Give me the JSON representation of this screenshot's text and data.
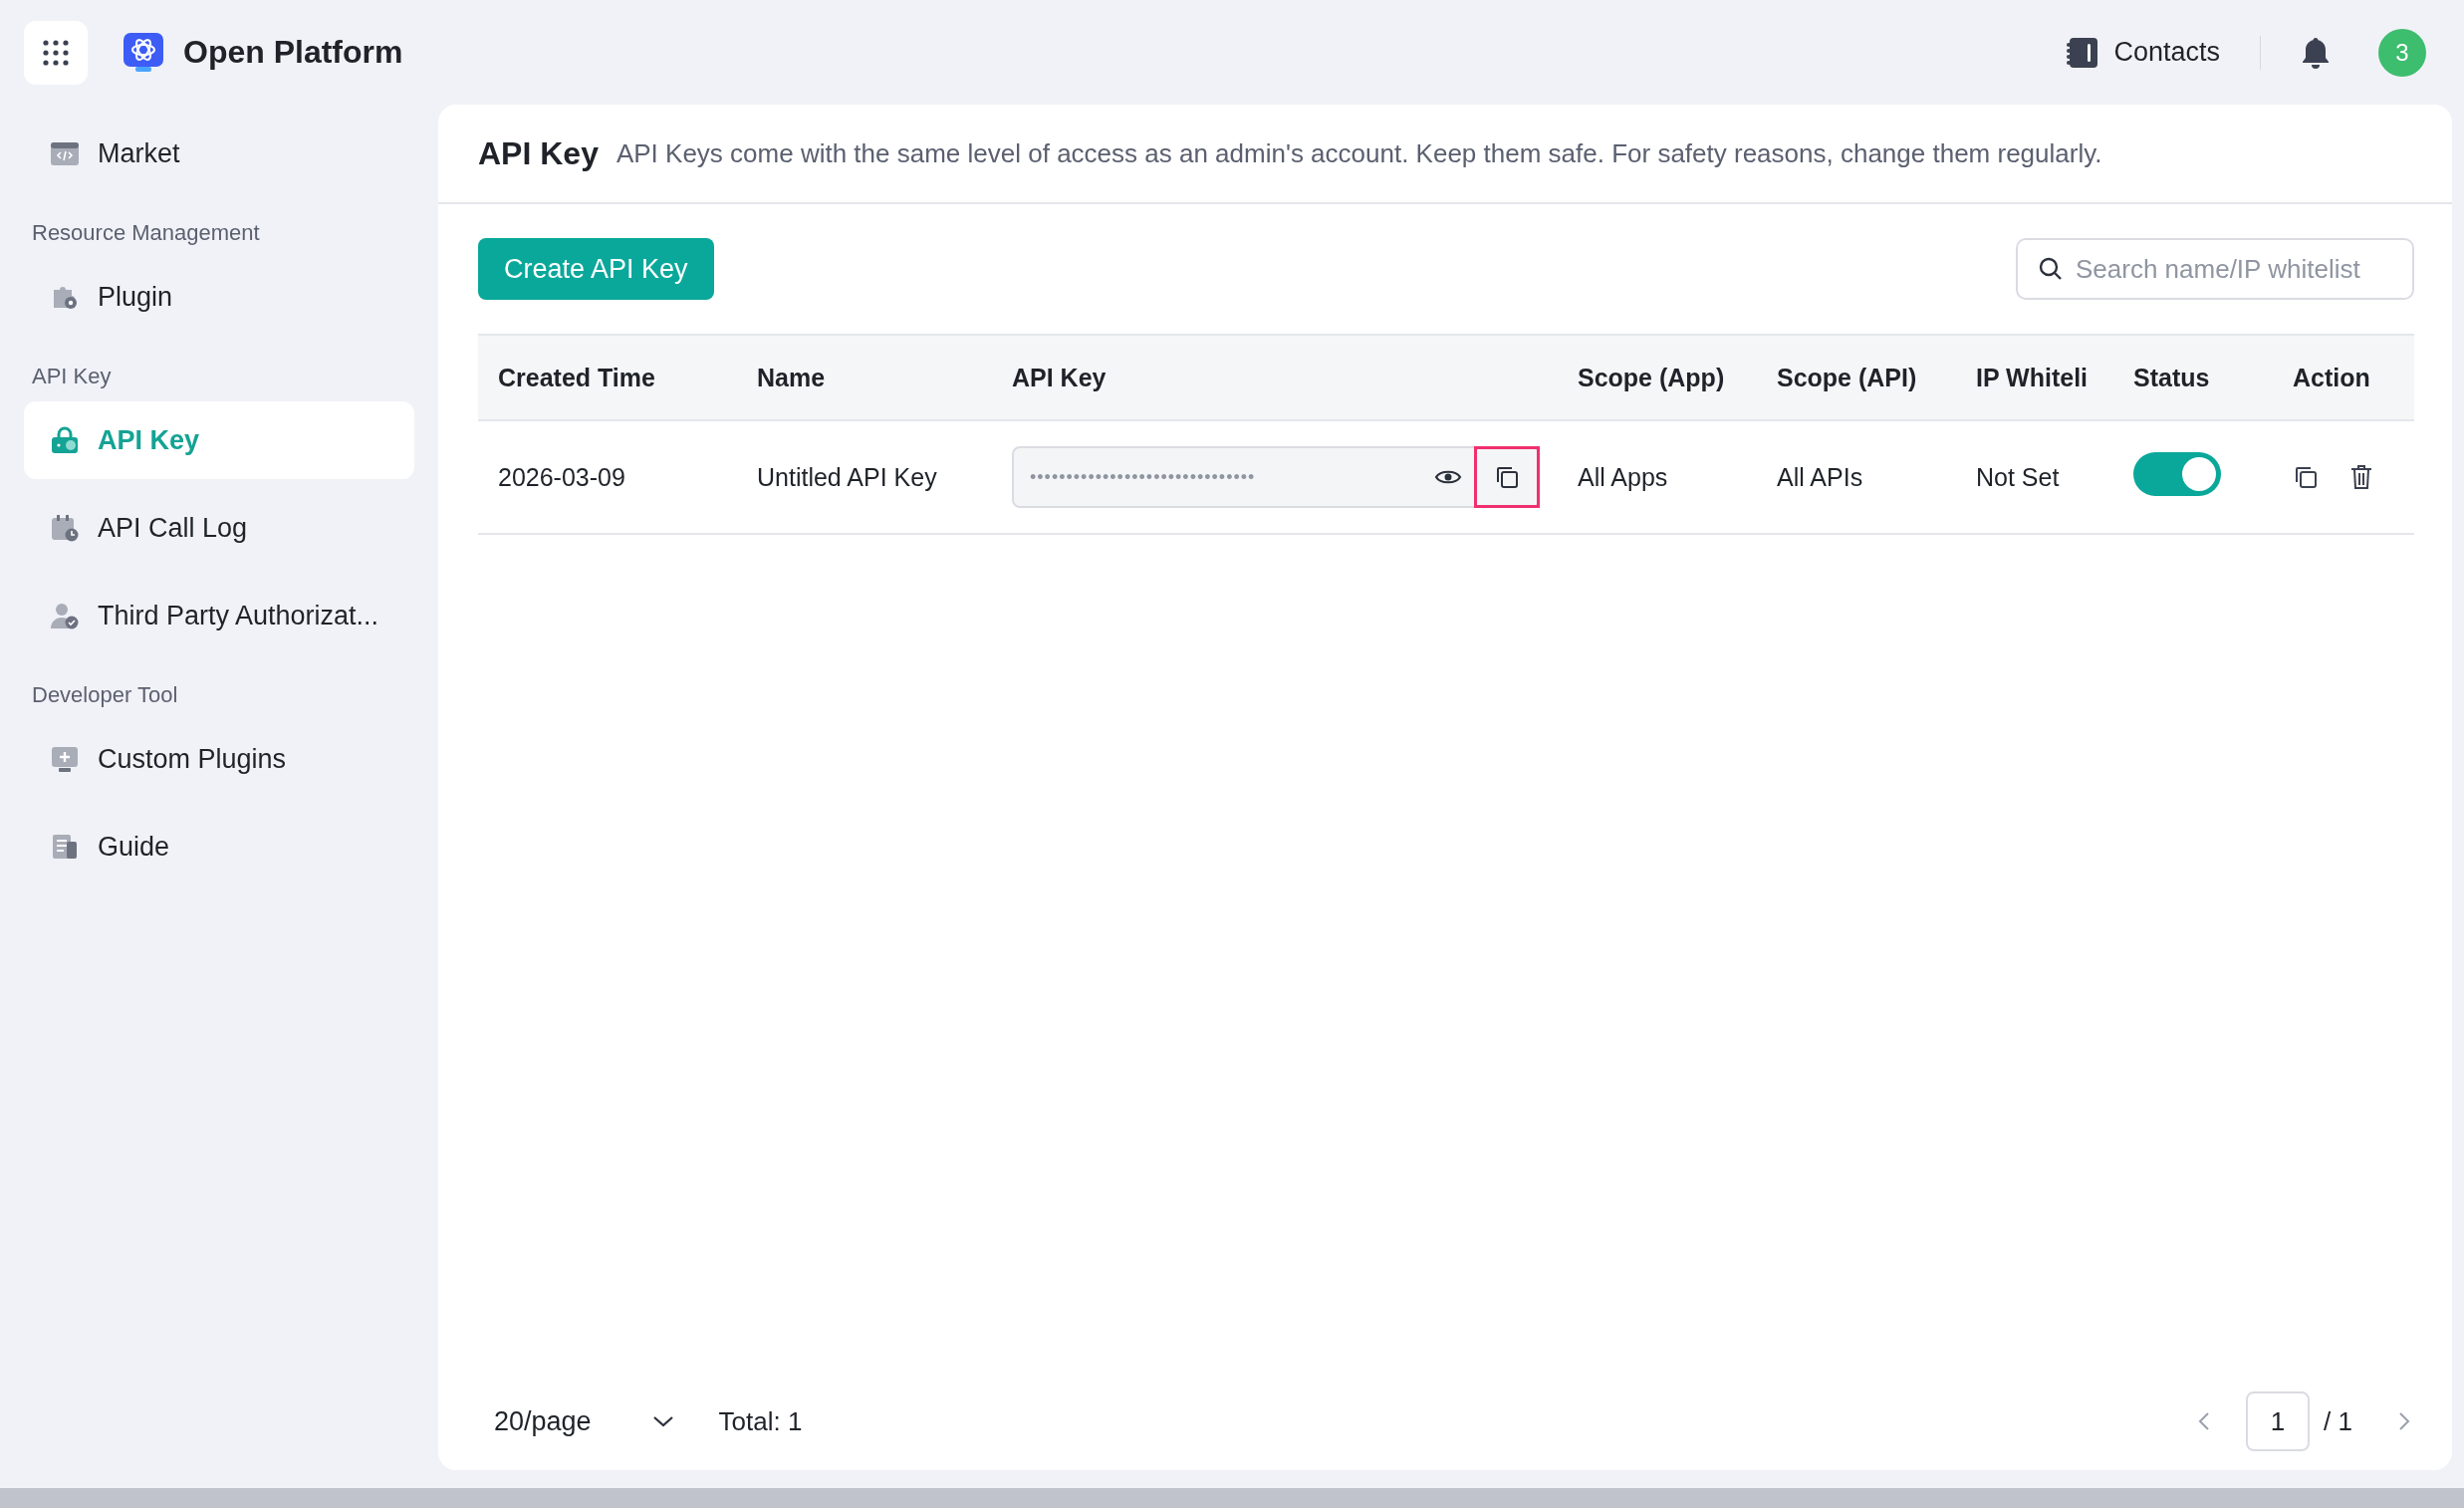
{
  "header": {
    "title": "Open Platform",
    "contacts": "Contacts",
    "avatar": "3"
  },
  "sidebar": {
    "sections": [
      {
        "items": [
          {
            "label": "Market",
            "selected": false
          }
        ]
      },
      {
        "heading": "Resource Management",
        "items": [
          {
            "label": "Plugin",
            "selected": false
          }
        ]
      },
      {
        "heading": "API Key",
        "items": [
          {
            "label": "API Key",
            "selected": true
          },
          {
            "label": "API Call Log",
            "selected": false
          },
          {
            "label": "Third Party Authorizat...",
            "selected": false
          }
        ]
      },
      {
        "heading": "Developer Tool",
        "items": [
          {
            "label": "Custom Plugins",
            "selected": false
          },
          {
            "label": "Guide",
            "selected": false
          }
        ]
      }
    ]
  },
  "page": {
    "title": "API Key",
    "description": "API Keys come with the same level of access as an admin's account. Keep them safe. For safety reasons, change them regularly.",
    "create_button": "Create API Key",
    "search": {
      "placeholder": "Search name/IP whitelist"
    }
  },
  "table": {
    "columns": [
      "Created Time",
      "Name",
      "API Key",
      "Scope (App)",
      "Scope (API)",
      "IP Whiteli",
      "Status",
      "Action"
    ],
    "rows": [
      {
        "created": "2026-03-09",
        "name": "Untitled API Key",
        "api_key": "•••••••••••••••••••••••••••••••",
        "copy_highlighted": true,
        "scope_app": "All Apps",
        "scope_api": "All APIs",
        "ip_whitelist": "Not Set",
        "status_on": true
      }
    ]
  },
  "pagination": {
    "page_size": "20/page",
    "total": "Total: 1",
    "page": "1",
    "pages": "/ 1"
  }
}
